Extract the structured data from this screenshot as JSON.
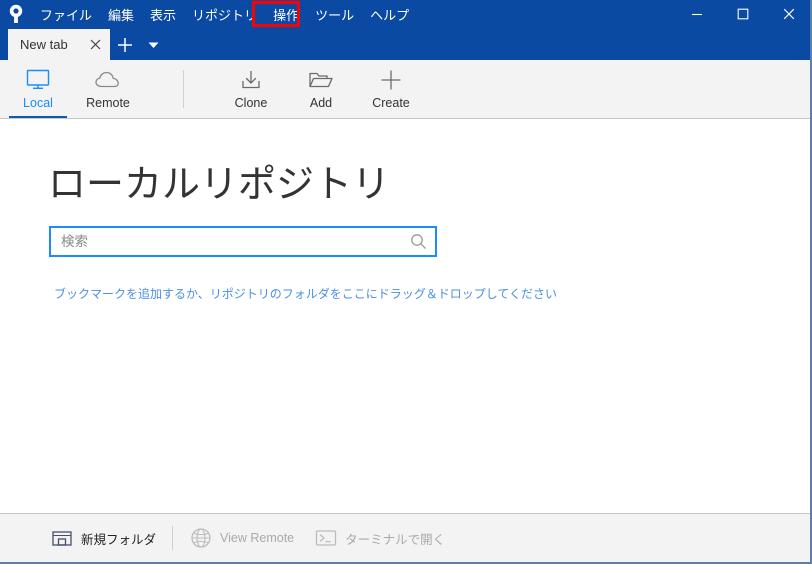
{
  "window": {
    "logo_icon": "sourcetree-logo-icon",
    "controls": {
      "minimize": "minimize-icon",
      "maximize": "maximize-icon",
      "close": "close-icon"
    },
    "accent_color": "#0b4aa2",
    "highlight_color": "#ff0000",
    "link_color": "#4a90e2",
    "active_color": "#1a8cff"
  },
  "menu": {
    "items": [
      {
        "label": "ファイル",
        "highlighted": false
      },
      {
        "label": "編集",
        "highlighted": false
      },
      {
        "label": "表示",
        "highlighted": false
      },
      {
        "label": "リポジトリ",
        "highlighted": false
      },
      {
        "label": "操作",
        "highlighted": false
      },
      {
        "label": "ツール",
        "highlighted": true
      },
      {
        "label": "ヘルプ",
        "highlighted": false
      }
    ]
  },
  "tabs": {
    "active_tab_label": "New tab",
    "close_label": "✕",
    "new_tab_label": "+",
    "dropdown_label": "▾"
  },
  "toolbar": {
    "items": [
      {
        "label": "Local",
        "icon": "monitor-icon",
        "active": true
      },
      {
        "label": "Remote",
        "icon": "cloud-icon",
        "active": false
      },
      {
        "label": "Clone",
        "icon": "clone-download-icon",
        "active": false
      },
      {
        "label": "Add",
        "icon": "folder-open-icon",
        "active": false
      },
      {
        "label": "Create",
        "icon": "plus-icon",
        "active": false
      }
    ]
  },
  "main": {
    "title": "ローカルリポジトリ",
    "search": {
      "value": "",
      "placeholder": "検索",
      "icon": "search-icon"
    },
    "drop_hint": "ブックマークを追加するか、リポジトリのフォルダをここにドラッグ＆ドロップしてください"
  },
  "status_bar": {
    "items": [
      {
        "label": "新規フォルダ",
        "icon": "new-folder-icon",
        "enabled": true
      },
      {
        "label": "View Remote",
        "icon": "globe-icon",
        "enabled": false
      },
      {
        "label": "ターミナルで開く",
        "icon": "terminal-icon",
        "enabled": false
      }
    ]
  }
}
